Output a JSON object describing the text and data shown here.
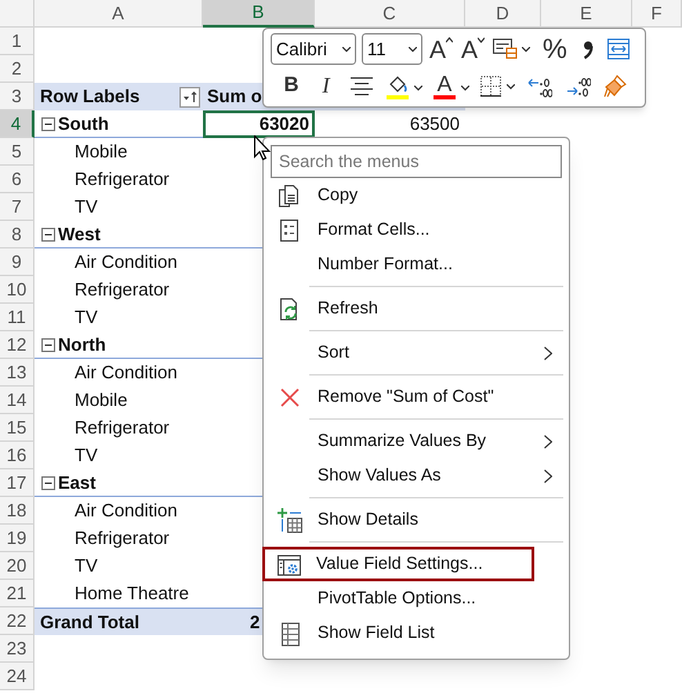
{
  "columns": [
    {
      "label": "A",
      "selected": false
    },
    {
      "label": "B",
      "selected": true
    },
    {
      "label": "C",
      "selected": false
    },
    {
      "label": "D",
      "selected": false
    },
    {
      "label": "E",
      "selected": false
    },
    {
      "label": "F",
      "selected": false
    }
  ],
  "rows": [
    {
      "number": "1",
      "selected": false,
      "kind": "blank"
    },
    {
      "number": "2",
      "selected": false,
      "kind": "blank"
    },
    {
      "number": "3",
      "selected": false,
      "kind": "header",
      "label": "Row Labels",
      "values": [
        "Sum o"
      ]
    },
    {
      "number": "4",
      "selected": true,
      "kind": "group",
      "label": "South",
      "values": [
        "63020",
        "63500"
      ]
    },
    {
      "number": "5",
      "selected": false,
      "kind": "item",
      "label": "Mobile"
    },
    {
      "number": "6",
      "selected": false,
      "kind": "item",
      "label": "Refrigerator"
    },
    {
      "number": "7",
      "selected": false,
      "kind": "item",
      "label": "TV"
    },
    {
      "number": "8",
      "selected": false,
      "kind": "group",
      "label": "West"
    },
    {
      "number": "9",
      "selected": false,
      "kind": "item",
      "label": "Air Condition"
    },
    {
      "number": "10",
      "selected": false,
      "kind": "item",
      "label": "Refrigerator"
    },
    {
      "number": "11",
      "selected": false,
      "kind": "item",
      "label": "TV"
    },
    {
      "number": "12",
      "selected": false,
      "kind": "group",
      "label": "North"
    },
    {
      "number": "13",
      "selected": false,
      "kind": "item",
      "label": "Air Condition"
    },
    {
      "number": "14",
      "selected": false,
      "kind": "item",
      "label": "Mobile"
    },
    {
      "number": "15",
      "selected": false,
      "kind": "item",
      "label": "Refrigerator"
    },
    {
      "number": "16",
      "selected": false,
      "kind": "item",
      "label": "TV"
    },
    {
      "number": "17",
      "selected": false,
      "kind": "group",
      "label": "East"
    },
    {
      "number": "18",
      "selected": false,
      "kind": "item",
      "label": "Air Condition"
    },
    {
      "number": "19",
      "selected": false,
      "kind": "item",
      "label": "Refrigerator"
    },
    {
      "number": "20",
      "selected": false,
      "kind": "item",
      "label": "TV"
    },
    {
      "number": "21",
      "selected": false,
      "kind": "item",
      "label": "Home Theatre"
    },
    {
      "number": "22",
      "selected": false,
      "kind": "total",
      "label": "Grand Total",
      "values": [
        "2"
      ]
    },
    {
      "number": "23",
      "selected": false,
      "kind": "blank"
    },
    {
      "number": "24",
      "selected": false,
      "kind": "blank"
    }
  ],
  "mini_toolbar": {
    "rows": [
      [
        {
          "kind": "font",
          "value": "Calibri"
        },
        {
          "kind": "size",
          "value": "11"
        },
        {
          "kind": "grow",
          "label": "A"
        },
        {
          "kind": "shrink",
          "label": "A"
        },
        {
          "kind": "cellstyle"
        },
        {
          "kind": "percent",
          "label": "%"
        },
        {
          "kind": "comma"
        },
        {
          "kind": "merge"
        }
      ],
      [
        {
          "kind": "bold",
          "label": "B"
        },
        {
          "kind": "italic",
          "label": "I"
        },
        {
          "kind": "center"
        },
        {
          "kind": "fill",
          "color": "#ffff00"
        },
        {
          "kind": "fontcolor",
          "label": "A",
          "color": "#ff0000"
        },
        {
          "kind": "borders"
        },
        {
          "kind": "incdec"
        },
        {
          "kind": "decdec"
        },
        {
          "kind": "painter"
        }
      ]
    ]
  },
  "context_menu": {
    "search": {
      "placeholder": "Search the menus"
    },
    "sections": [
      [
        {
          "label": "Copy",
          "kind": "copy",
          "submenu": false,
          "selected": false
        },
        {
          "label": "Format Cells...",
          "kind": "format",
          "submenu": false,
          "selected": false
        },
        {
          "label": "Number Format...",
          "submenu": false,
          "selected": false
        }
      ],
      [
        {
          "label": "Refresh",
          "kind": "refresh",
          "submenu": false,
          "selected": false
        }
      ],
      [
        {
          "label": "Sort",
          "submenu": true,
          "selected": false
        }
      ],
      [
        {
          "label": "Remove \"Sum of Cost\"",
          "kind": "remove",
          "submenu": false,
          "selected": false
        }
      ],
      [
        {
          "label": "Summarize Values By",
          "submenu": true,
          "selected": false
        },
        {
          "label": "Show Values As",
          "submenu": true,
          "selected": false
        }
      ],
      [
        {
          "label": "Show Details",
          "kind": "details",
          "submenu": false,
          "selected": false
        }
      ],
      [
        {
          "label": "Value Field Settings...",
          "kind": "settings",
          "submenu": false,
          "selected": true
        },
        {
          "label": "PivotTable Options...",
          "submenu": false,
          "selected": false
        },
        {
          "label": "Show Field List",
          "kind": "list",
          "submenu": false,
          "selected": false
        }
      ]
    ]
  }
}
